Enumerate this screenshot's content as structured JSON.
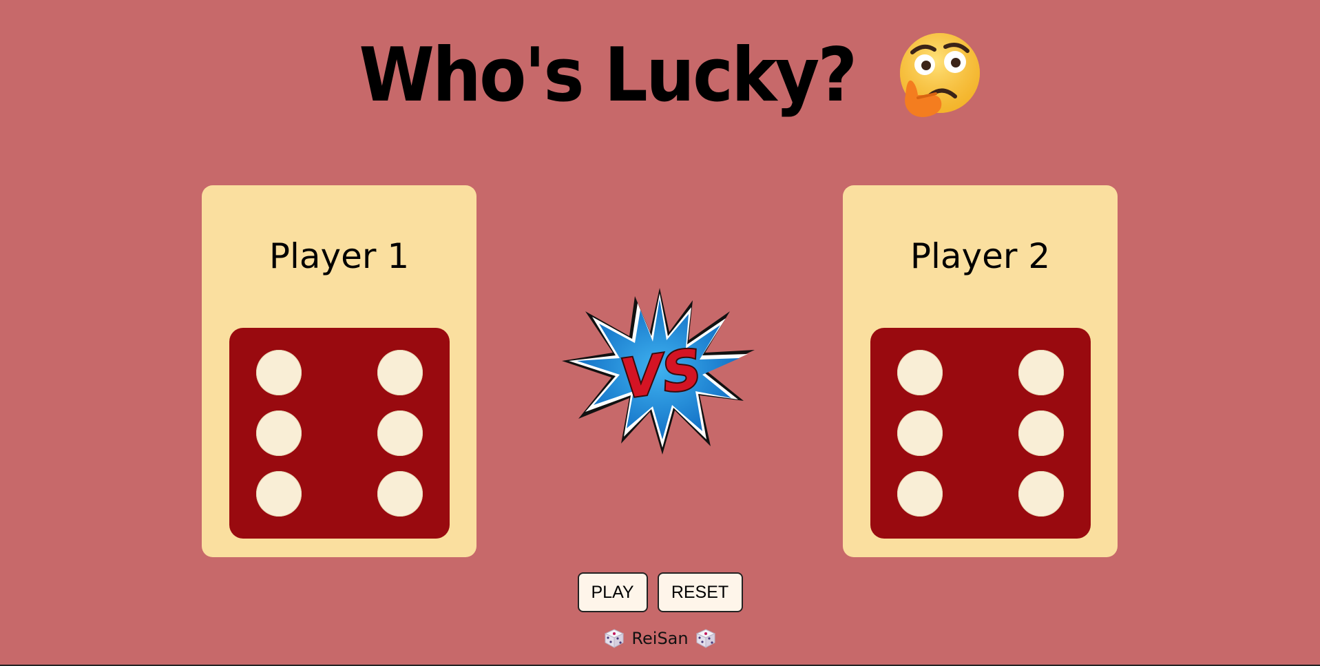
{
  "title": {
    "text": "Who's Lucky?",
    "emoji_icon": "thinking-face-icon"
  },
  "players": [
    {
      "label": "Player 1",
      "die_value": 6
    },
    {
      "label": "Player 2",
      "die_value": 6
    }
  ],
  "versus": {
    "text": "VS",
    "icon": "vs-burst-icon"
  },
  "buttons": {
    "play_label": "PLAY",
    "reset_label": "RESET"
  },
  "footer": {
    "author": "ReiSan",
    "icon": "die-icon"
  },
  "colors": {
    "background": "#c7696a",
    "card": "#fadf9f",
    "die": "#990a0f",
    "pip": "#f9eed6",
    "button": "#fef5ea"
  }
}
